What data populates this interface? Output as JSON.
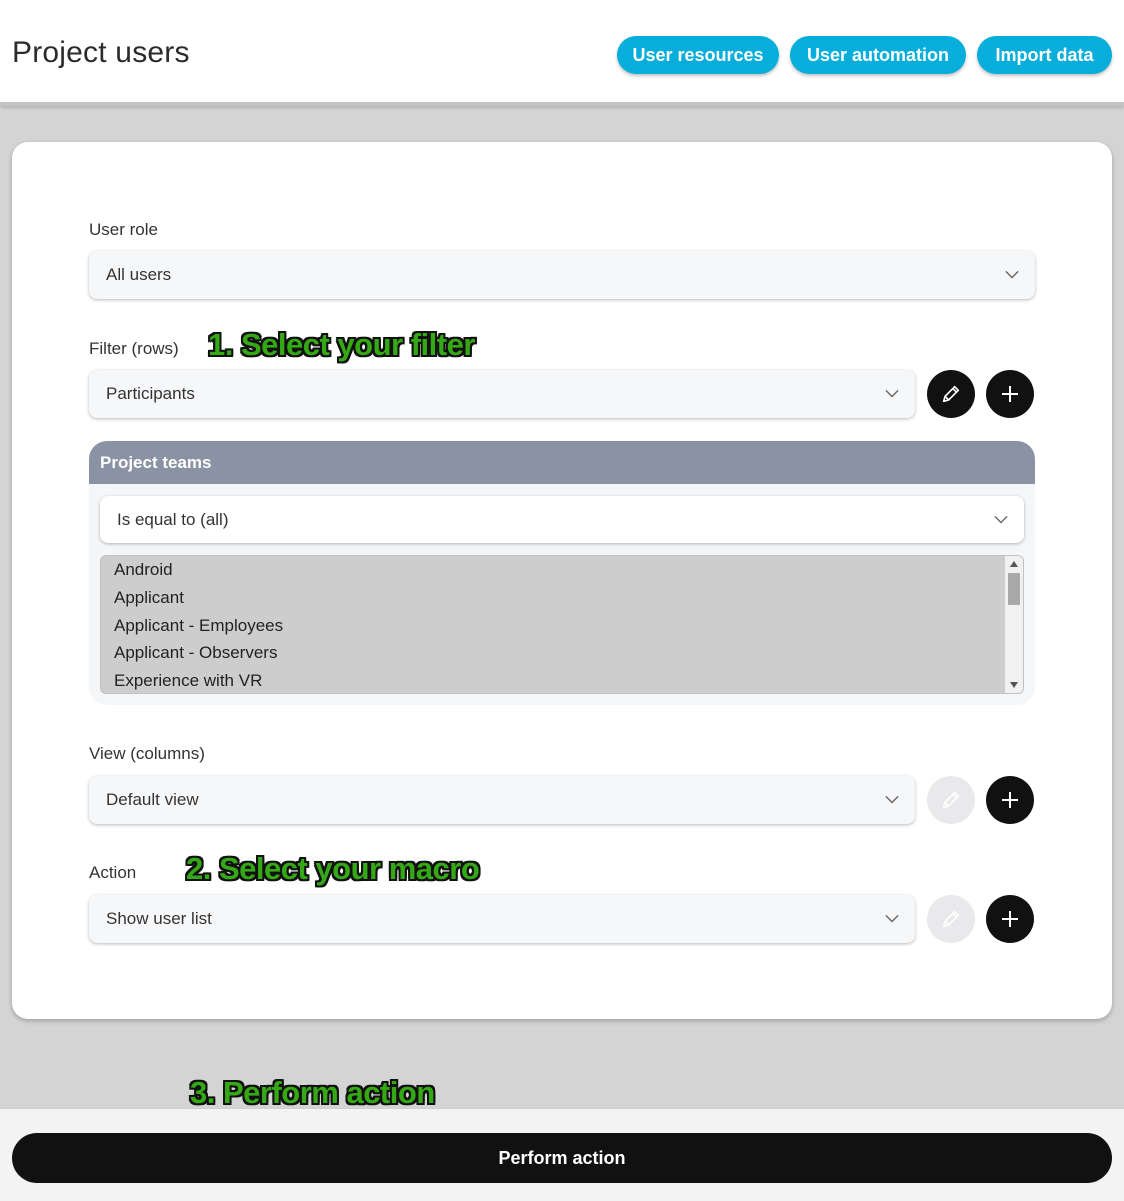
{
  "header": {
    "title": "Project users",
    "buttons": {
      "resources": "User resources",
      "automation": "User automation",
      "import": "Import data"
    }
  },
  "form": {
    "user_role": {
      "label": "User role",
      "value": "All users"
    },
    "filter": {
      "label": "Filter (rows)",
      "value": "Participants"
    },
    "project_teams": {
      "title": "Project teams",
      "operator": "Is equal to (all)",
      "options": [
        "Android",
        "Applicant",
        "Applicant - Employees",
        "Applicant - Observers",
        "Experience with VR"
      ]
    },
    "view": {
      "label": "View (columns)",
      "value": "Default view"
    },
    "action": {
      "label": "Action",
      "value": "Show user list"
    }
  },
  "annotations": {
    "step1": "1. Select your filter",
    "step2": "2. Select your macro",
    "step3": "3. Perform action"
  },
  "footer": {
    "perform_label": "Perform action"
  },
  "colors": {
    "accent": "#07aedb",
    "annotation": "#35a816",
    "panel_header": "#8a93a4",
    "dark_button": "#111111"
  },
  "icons": {
    "edit": "pencil-icon",
    "add": "plus-icon",
    "dropdown": "chevron-down-icon"
  }
}
